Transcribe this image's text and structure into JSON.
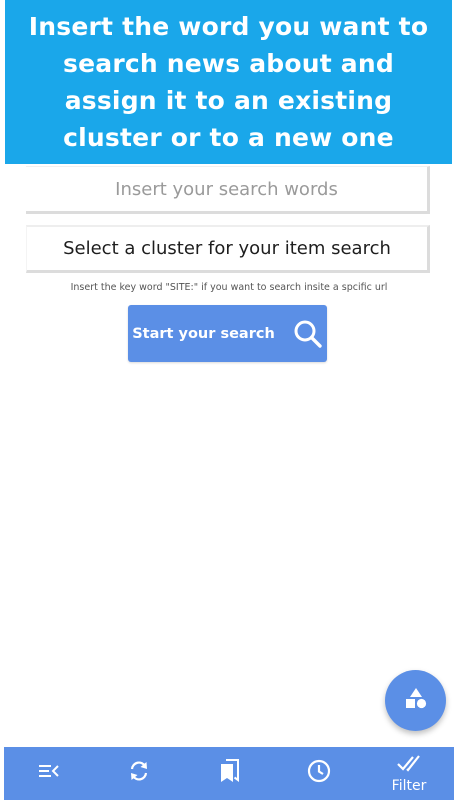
{
  "banner": {
    "text": "Insert the word you want to search news about and assign it to an existing cluster or to a new one"
  },
  "search": {
    "placeholder": "Insert your search words",
    "value": ""
  },
  "cluster_select": {
    "label": "Select a cluster for your item search"
  },
  "hint": "Insert the key word \"SITE:\" if you want to search insite a spcific url",
  "start_button": {
    "label": "Start your search",
    "icon": "search-icon"
  },
  "fab": {
    "icon": "shapes-icon"
  },
  "bottom_nav": {
    "items": [
      {
        "icon": "menu-collapse-icon",
        "label": ""
      },
      {
        "icon": "refresh-icon",
        "label": ""
      },
      {
        "icon": "bookmarks-icon",
        "label": ""
      },
      {
        "icon": "clock-icon",
        "label": ""
      },
      {
        "icon": "check-all-icon",
        "label": "Filter"
      }
    ]
  },
  "colors": {
    "banner": "#1aa7ea",
    "accent": "#5b8fe6",
    "text": "#1e1e1e",
    "placeholder": "#9a9a9a"
  }
}
